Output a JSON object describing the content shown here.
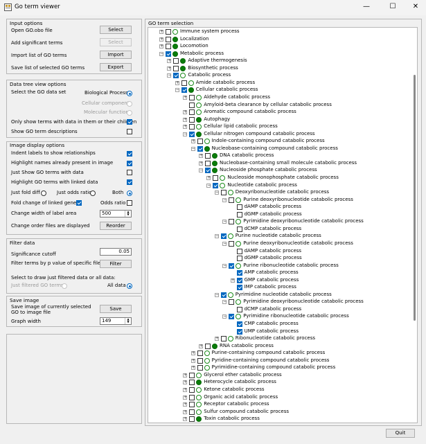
{
  "window": {
    "title": "Go term viewer",
    "minimize": "—",
    "maximize": "☐",
    "close": "✕"
  },
  "input_options": {
    "heading": "Input options",
    "open_label": "Open GO.obo file",
    "open_btn": "Select",
    "add_label": "Add significant terms",
    "add_btn": "Select",
    "import_label": "Import list of GO terms",
    "import_btn": "Import",
    "save_label": "Save list of selected GO terms",
    "save_btn": "Export"
  },
  "data_tree": {
    "heading": "Data tree view options",
    "select_label": "Select the GO data set",
    "bp": "Biological Process",
    "cc": "Cellular component",
    "mf": "Molecular function",
    "only_show": "Only show terms with data in them or their children",
    "show_desc": "Show GO term descriptions"
  },
  "image_display": {
    "heading": "Image display options",
    "indent": "Indent labels to show relationships",
    "highlight_names": "Highlight names already present in image",
    "just_show": "Just Show GO terms with data",
    "highlight_linked": "Highlight GO terms with linked data",
    "just_fold": "Just fold diff",
    "just_odds": "Just odds ratio",
    "both": "Both",
    "fold_change": "Fold change of linked genes",
    "odds_ratio": "Odds ratio",
    "change_width": "Change width of label area",
    "width_value": "500",
    "change_order": "Change order files are displayed",
    "reorder_btn": "Reorder"
  },
  "filter": {
    "heading": "Filter data",
    "sig_label": "Significance cutoff",
    "sig_value": "0.05",
    "filter_label": "Filter terms by p value of specific file(s)",
    "filter_btn": "Filter",
    "select_draw": "Select to draw just filtered data or all data:",
    "just_filtered": "Just filtered GO terms",
    "all_data": "All data"
  },
  "save_image": {
    "heading": "Save image",
    "save_label": "Save image of currently selected GO to image file",
    "save_btn": "Save",
    "graph_width": "Graph width",
    "graph_value": "149"
  },
  "tree": {
    "heading": "GO term selection",
    "rows": [
      {
        "t": "Immune system process",
        "l": 0,
        "e": "+",
        "c": false,
        "d": "hollow"
      },
      {
        "t": "Localization",
        "l": 0,
        "e": "+",
        "c": false,
        "d": "green"
      },
      {
        "t": "Locomotion",
        "l": 0,
        "e": "+",
        "c": false,
        "d": "green"
      },
      {
        "t": "Metabolic process",
        "l": 0,
        "e": "−",
        "c": true,
        "d": "green"
      },
      {
        "t": "Adaptive thermogenesis",
        "l": 1,
        "e": "+",
        "c": false,
        "d": "green"
      },
      {
        "t": "Biosynthetic process",
        "l": 1,
        "e": "+",
        "c": false,
        "d": "green"
      },
      {
        "t": "Catabolic process",
        "l": 1,
        "e": "−",
        "c": true,
        "d": "hollow"
      },
      {
        "t": "Amide catabolic process",
        "l": 2,
        "e": "+",
        "c": false,
        "d": "hollow"
      },
      {
        "t": "Cellular catabolic process",
        "l": 2,
        "e": "−",
        "c": true,
        "d": "green"
      },
      {
        "t": "Aldehyde catabolic process",
        "l": 3,
        "e": "+",
        "c": false,
        "d": "hollow"
      },
      {
        "t": "Amyloid-beta clearance by cellular catabolic process",
        "l": 3,
        "e": "",
        "c": false,
        "d": "hollow"
      },
      {
        "t": "Aromatic compound catabolic process",
        "l": 3,
        "e": "+",
        "c": false,
        "d": "hollow"
      },
      {
        "t": "Autophagy",
        "l": 3,
        "e": "+",
        "c": false,
        "d": "green"
      },
      {
        "t": "Cellular lipid catabolic process",
        "l": 3,
        "e": "+",
        "c": false,
        "d": "hollow"
      },
      {
        "t": "Cellular nitrogen compound catabolic process",
        "l": 3,
        "e": "−",
        "c": true,
        "d": "green"
      },
      {
        "t": "Indole-containing compound catabolic process",
        "l": 4,
        "e": "+",
        "c": false,
        "d": "hollow"
      },
      {
        "t": "Nucleobase-containing compound catabolic process",
        "l": 4,
        "e": "−",
        "c": true,
        "d": "green"
      },
      {
        "t": "DNA catabolic process",
        "l": 5,
        "e": "+",
        "c": false,
        "d": "green"
      },
      {
        "t": "Nucleobase-containing small molecule catabolic process",
        "l": 5,
        "e": "+",
        "c": false,
        "d": "green"
      },
      {
        "t": "Nucleoside phosphate catabolic process",
        "l": 5,
        "e": "−",
        "c": true,
        "d": "green"
      },
      {
        "t": "Nucleoside monophosphate catabolic process",
        "l": 6,
        "e": "+",
        "c": false,
        "d": "hollow"
      },
      {
        "t": "Nucleotide catabolic process",
        "l": 6,
        "e": "−",
        "c": true,
        "d": "hollow"
      },
      {
        "t": "Deoxyribonucleotide catabolic process",
        "l": 7,
        "e": "−",
        "c": false,
        "d": "hollow"
      },
      {
        "t": "Purine deoxyribonucleotide catabolic process",
        "l": 8,
        "e": "−",
        "c": false,
        "d": "hollow"
      },
      {
        "t": "dAMP catabolic process",
        "l": 9,
        "e": "",
        "c": false,
        "d": ""
      },
      {
        "t": "dGMP catabolic process",
        "l": 9,
        "e": "",
        "c": false,
        "d": ""
      },
      {
        "t": "Pyrimidine deoxyribonucleotide catabolic process",
        "l": 8,
        "e": "−",
        "c": false,
        "d": "hollow"
      },
      {
        "t": "dCMP catabolic process",
        "l": 9,
        "e": "",
        "c": false,
        "d": ""
      },
      {
        "t": "Purine nucleotide catabolic process",
        "l": 7,
        "e": "−",
        "c": true,
        "d": "hollow"
      },
      {
        "t": "Purine deoxyribonucleotide catabolic process",
        "l": 8,
        "e": "−",
        "c": false,
        "d": "hollow"
      },
      {
        "t": "dAMP catabolic process",
        "l": 9,
        "e": "",
        "c": false,
        "d": ""
      },
      {
        "t": "dGMP catabolic process",
        "l": 9,
        "e": "",
        "c": false,
        "d": ""
      },
      {
        "t": "Purine ribonucleotide catabolic process",
        "l": 8,
        "e": "−",
        "c": true,
        "d": "hollow"
      },
      {
        "t": "AMP catabolic process",
        "l": 9,
        "e": "",
        "c": true,
        "d": ""
      },
      {
        "t": "GMP catabolic process",
        "l": 9,
        "e": "+",
        "c": true,
        "d": ""
      },
      {
        "t": "IMP catabolic process",
        "l": 9,
        "e": "",
        "c": true,
        "d": ""
      },
      {
        "t": "Pyrimidine nucleotide catabolic process",
        "l": 7,
        "e": "−",
        "c": true,
        "d": "hollow"
      },
      {
        "t": "Pyrimidine deoxyribonucleotide catabolic process",
        "l": 8,
        "e": "−",
        "c": false,
        "d": "hollow"
      },
      {
        "t": "dCMP catabolic process",
        "l": 9,
        "e": "",
        "c": false,
        "d": ""
      },
      {
        "t": "Pyrimidine ribonucleotide catabolic process",
        "l": 8,
        "e": "−",
        "c": true,
        "d": "hollow"
      },
      {
        "t": "CMP catabolic process",
        "l": 9,
        "e": "",
        "c": true,
        "d": ""
      },
      {
        "t": "UMP catabolic process",
        "l": 9,
        "e": "",
        "c": true,
        "d": ""
      },
      {
        "t": "Ribonucleotide catabolic process",
        "l": 7,
        "e": "+",
        "c": false,
        "d": "hollow"
      },
      {
        "t": "RNA catabolic process",
        "l": 5,
        "e": "+",
        "c": false,
        "d": "green"
      },
      {
        "t": "Purine-containing compound catabolic process",
        "l": 4,
        "e": "+",
        "c": false,
        "d": "hollow"
      },
      {
        "t": "Pyridine-containing compound catabolic process",
        "l": 4,
        "e": "+",
        "c": false,
        "d": "hollow"
      },
      {
        "t": "Pyrimidine-containing compound catabolic process",
        "l": 4,
        "e": "+",
        "c": false,
        "d": "hollow"
      },
      {
        "t": "Glycerol ether catabolic process",
        "l": 3,
        "e": "+",
        "c": false,
        "d": "hollow"
      },
      {
        "t": "Heterocycle catabolic process",
        "l": 3,
        "e": "+",
        "c": false,
        "d": "green"
      },
      {
        "t": "Ketone catabolic process",
        "l": 3,
        "e": "+",
        "c": false,
        "d": "hollow"
      },
      {
        "t": "Organic acid catabolic process",
        "l": 3,
        "e": "+",
        "c": false,
        "d": "hollow"
      },
      {
        "t": "Receptor catabolic process",
        "l": 3,
        "e": "+",
        "c": false,
        "d": "hollow"
      },
      {
        "t": "Sulfur compound catabolic process",
        "l": 3,
        "e": "+",
        "c": false,
        "d": "hollow"
      },
      {
        "t": "Toxin catabolic process",
        "l": 3,
        "e": "+",
        "c": false,
        "d": "green"
      }
    ]
  },
  "footer": {
    "quit_btn": "Quit"
  },
  "colors": {
    "accent": "#0067c0",
    "term_green": "#0a7d0a"
  }
}
